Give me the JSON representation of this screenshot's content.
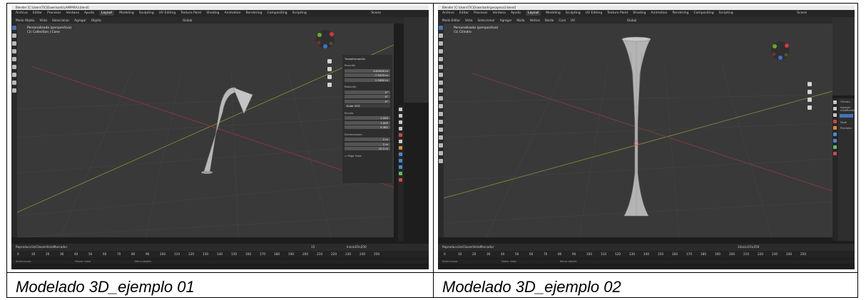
{
  "captions": {
    "left": "Modelado 3D_ejemplo 01",
    "right": "Modelado 3D_ejemplo 02"
  },
  "screenshot_left": {
    "window_title": "Blender [C:\\Users\\TIC\\Downloads\\LAMPARA3.blend]",
    "menu": [
      "Archivo",
      "Editar",
      "Procesar",
      "Ventana",
      "Ayuda",
      "Layout",
      "Modeling",
      "Sculpting",
      "UV Editing",
      "Texture Paint",
      "Shading",
      "Animation",
      "Rendering",
      "Compositing",
      "Scripting"
    ],
    "active_workspace": "Layout",
    "scene": "Scene",
    "header_items": [
      "Modo Objeto",
      "Vista",
      "Seleccionar",
      "Agregar",
      "Objeto"
    ],
    "transform_orientation": "Global",
    "viewport_overlay_lines": [
      "Personalizado (perspectiva)",
      "(1) Collection | Cone"
    ],
    "n_panel": {
      "title": "Transformación",
      "location_label": "Posición",
      "location": [
        "0.00000 m",
        "-7.5033 m",
        "1.5950 m"
      ],
      "rotation_label": "Rotación",
      "rotation": [
        "0°",
        "0°",
        "0°"
      ],
      "rotation_mode": "Euler XYZ",
      "scale_label": "Escala",
      "scale": [
        "1.000",
        "1.000",
        "0.381"
      ],
      "dimensions_label": "Dimensiones",
      "dimensions": [
        "2 m",
        "2 m",
        "10.3 m"
      ],
      "axes": [
        "X",
        "Y",
        "Z"
      ],
      "footer": "> Migo Tools"
    },
    "timeline_items": [
      "Reproducción",
      "Claves",
      "Vista",
      "Marcador"
    ],
    "timeline_fields": [
      "Inicio",
      "1",
      "Fin",
      "250"
    ],
    "current_frame": "15",
    "frame_ticks": [
      "0",
      "10",
      "20",
      "30",
      "40",
      "50",
      "60",
      "70",
      "80",
      "90",
      "100",
      "110",
      "120",
      "130",
      "140",
      "150",
      "160",
      "170",
      "180",
      "190",
      "200",
      "210",
      "220",
      "230",
      "240",
      "250"
    ],
    "status": [
      "Seleccionar",
      "Mover vista",
      "Menú objeto"
    ]
  },
  "screenshot_right": {
    "window_title": "Blender [C:\\Users\\TIC\\Downloads\\pesapesa3.blend]",
    "menu": [
      "Archivo",
      "Editar",
      "Procesar",
      "Ventana",
      "Ayuda",
      "Layout",
      "Modeling",
      "Sculpting",
      "UV Editing",
      "Texture Paint",
      "Shading",
      "Animation",
      "Rendering",
      "Compositing",
      "Scripting"
    ],
    "active_workspace": "Layout",
    "scene": "Scene",
    "header_items": [
      "Modo Editar",
      "Vista",
      "Seleccionar",
      "Agregar",
      "Malla",
      "Vértice",
      "Borde",
      "Cara",
      "UV"
    ],
    "transform_orientation": "Global",
    "viewport_overlay_lines": [
      "Personalizado (perspectiva)",
      "(1) Cilindro"
    ],
    "props": {
      "object": "Cilindro",
      "modifier_button": "Agregar modificador",
      "field_label": "Nivel",
      "field_label2": "Precisión"
    },
    "timeline_items": [
      "Reproducción",
      "Claves",
      "Vista",
      "Marcador"
    ],
    "timeline_fields": [
      "1",
      "Inicio",
      "1",
      "Fin",
      "250"
    ],
    "frame_ticks": [
      "0",
      "10",
      "20",
      "30",
      "40",
      "50",
      "60",
      "70",
      "80",
      "90",
      "100",
      "110",
      "120",
      "130",
      "140",
      "150",
      "160",
      "170",
      "180",
      "190",
      "200",
      "210",
      "220",
      "230",
      "240",
      "250"
    ],
    "status": [
      "Seleccionar",
      "Rotar vista",
      "Menú objeto"
    ]
  }
}
